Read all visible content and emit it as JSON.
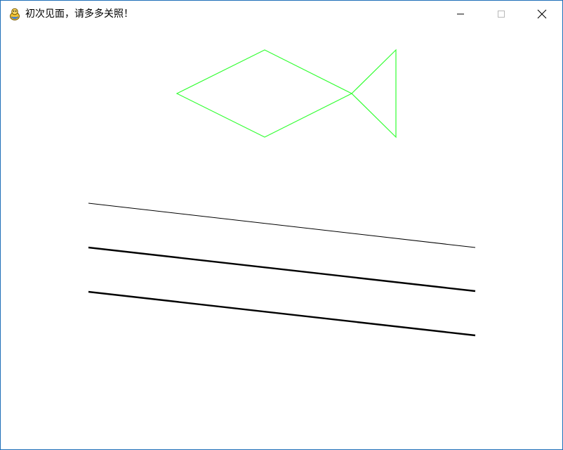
{
  "window": {
    "title": "初次见面，请多多关照！",
    "icon": "pygame-snake-icon",
    "controls": {
      "minimize_icon": "minimize-icon",
      "maximize_icon": "maximize-icon",
      "close_icon": "close-icon"
    }
  },
  "colors": {
    "background": "#ffffff",
    "fish_stroke": "#33ff33",
    "line_stroke": "#000000",
    "window_border": "#1f6fb8"
  }
}
